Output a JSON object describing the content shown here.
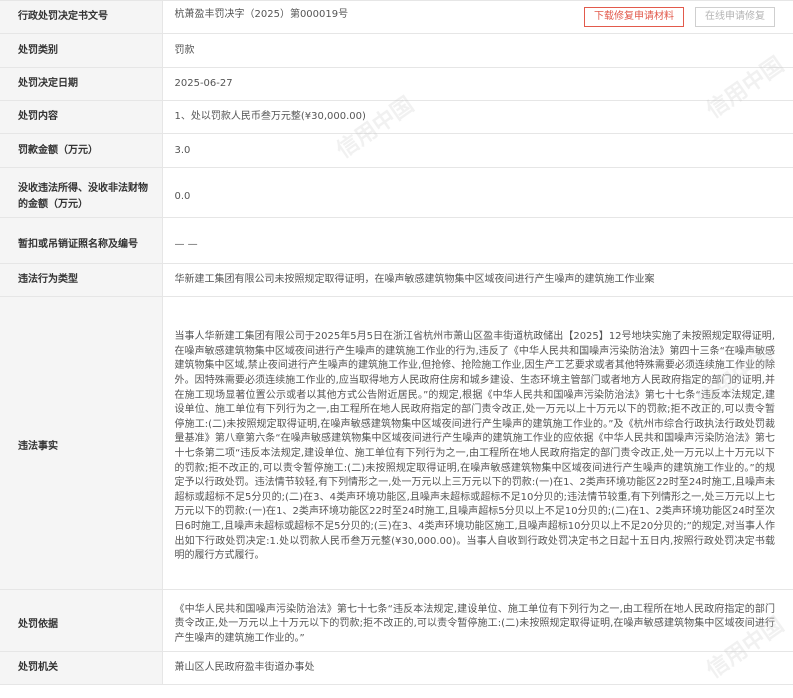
{
  "rows": {
    "decision_no": {
      "label": "行政处罚决定书文号",
      "value": "杭萧盈丰罚决字（2025）第000019号",
      "download_btn": "下载修复申请材料",
      "online_btn": "在线申请修复"
    },
    "category": {
      "label": "处罚类别",
      "value": "罚款"
    },
    "date": {
      "label": "处罚决定日期",
      "value": "2025-06-27"
    },
    "content": {
      "label": "处罚内容",
      "value": "1、处以罚款人民币叁万元整(¥30,000.00)"
    },
    "fine_amount": {
      "label": "罚款金额（万元）",
      "value": "3.0"
    },
    "confiscation": {
      "label": "没收违法所得、没收非法财物的金额（万元）",
      "value": "0.0"
    },
    "license": {
      "label": "暂扣或吊销证照名称及编号",
      "value": "— —"
    },
    "violation_type": {
      "label": "违法行为类型",
      "value": "华新建工集团有限公司未按照规定取得证明，在噪声敏感建筑物集中区域夜间进行产生噪声的建筑施工作业案"
    },
    "facts": {
      "label": "违法事实",
      "value": "当事人华新建工集团有限公司于2025年5月5日在浙江省杭州市萧山区盈丰街道杭政储出【2025】12号地块实施了未按照规定取得证明,在噪声敏感建筑物集中区域夜间进行产生噪声的建筑施工作业的行为,违反了《中华人民共和国噪声污染防治法》第四十三条“在噪声敏感建筑物集中区域,禁止夜间进行产生噪声的建筑施工作业,但抢修、抢险施工作业,因生产工艺要求或者其他特殊需要必须连续施工作业的除外。因特殊需要必须连续施工作业的,应当取得地方人民政府住房和城乡建设、生态环境主管部门或者地方人民政府指定的部门的证明,并在施工现场显著位置公示或者以其他方式公告附近居民。”的规定,根据《中华人民共和国噪声污染防治法》第七十七条“违反本法规定,建设单位、施工单位有下列行为之一,由工程所在地人民政府指定的部门责令改正,处一万元以上十万元以下的罚款;拒不改正的,可以责令暂停施工:(二)未按照规定取得证明,在噪声敏感建筑物集中区域夜间进行产生噪声的建筑施工作业的。”及《杭州市综合行政执法行政处罚裁量基准》第八章第六条“在噪声敏感建筑物集中区域夜间进行产生噪声的建筑施工作业的应依据《中华人民共和国噪声污染防治法》第七十七条第二项“违反本法规定,建设单位、施工单位有下列行为之一,由工程所在地人民政府指定的部门责令改正,处一万元以上十万元以下的罚款;拒不改正的,可以责令暂停施工:(二)未按照规定取得证明,在噪声敏感建筑物集中区域夜间进行产生噪声的建筑施工作业的。”的规定予以行政处罚。违法情节较轻,有下列情形之一,处一万元以上三万元以下的罚款:(一)在1、2类声环境功能区22时至24时施工,且噪声未超标或超标不足5分贝的;(二)在3、4类声环境功能区,且噪声未超标或超标不足10分贝的;违法情节较重,有下列情形之一,处三万元以上七万元以下的罚款:(一)在1、2类声环境功能区22时至24时施工,且噪声超标5分贝以上不足10分贝的;(二)在1、2类声环境功能区24时至次日6时施工,且噪声未超标或超标不足5分贝的;(三)在3、4类声环境功能区施工,且噪声超标10分贝以上不足20分贝的;”的规定,对当事人作出如下行政处罚决定:1.处以罚款人民币叁万元整(¥30,000.00)。当事人自收到行政处罚决定书之日起十五日内,按照行政处罚决定书载明的履行方式履行。"
    },
    "basis": {
      "label": "处罚依据",
      "value": "《中华人民共和国噪声污染防治法》第七十七条“违反本法规定,建设单位、施工单位有下列行为之一,由工程所在地人民政府指定的部门责令改正,处一万元以上十万元以下的罚款;拒不改正的,可以责令暂停施工:(二)未按照规定取得证明,在噪声敏感建筑物集中区域夜间进行产生噪声的建筑施工作业的。”"
    },
    "authority": {
      "label": "处罚机关",
      "value": "萧山区人民政府盈丰街道办事处"
    }
  },
  "watermark": "信用中国"
}
